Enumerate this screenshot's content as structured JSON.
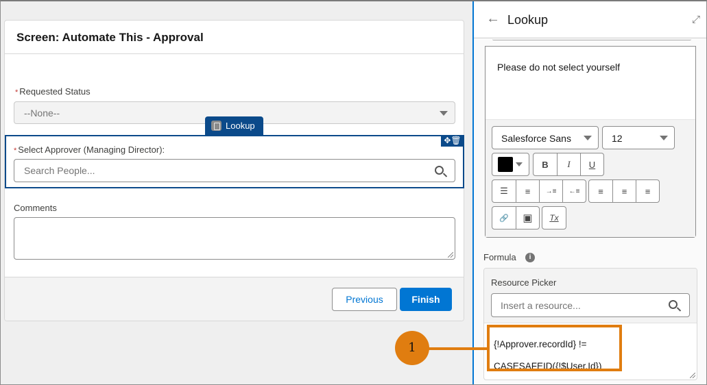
{
  "canvas": {
    "title": "Screen: Automate This - Approval",
    "fields": {
      "requested_status": {
        "label": "Requested Status",
        "required_marker": "*",
        "value": "--None--"
      },
      "approver": {
        "label": "Select Approver (Managing Director):",
        "required_marker": "*",
        "placeholder": "Search People...",
        "component_tab": "Lookup",
        "actions_glyph": "✥🗑"
      },
      "comments": {
        "label": "Comments",
        "value": ""
      }
    },
    "footer": {
      "previous_label": "Previous",
      "finish_label": "Finish"
    }
  },
  "panel": {
    "title": "Lookup",
    "back_glyph": "←",
    "expand_glyph": "⤢",
    "rich_text": {
      "content": "Please do not select yourself",
      "font_family": "Salesforce Sans",
      "font_size": "12",
      "text_color": "#000000",
      "toolbar": {
        "bold": "B",
        "italic": "I",
        "underline": "U",
        "bullet_list": "☰",
        "numbered_list": "≡",
        "indent": "→≡",
        "outdent": "←≡",
        "align_left": "≡",
        "align_center": "≡",
        "align_right": "≡",
        "link": "🔗",
        "image": "▣",
        "clear_format": "Tx"
      }
    },
    "formula": {
      "label": "Formula",
      "info_glyph": "i",
      "resource_picker_label": "Resource Picker",
      "resource_picker_placeholder": "Insert a resource...",
      "line1": "{!Approver.recordId} !=",
      "line2": "CASESAFEID({!$User.Id})"
    }
  },
  "callout": {
    "number": "1",
    "color": "#e07d10"
  },
  "colors": {
    "brand_blue": "#0176d3",
    "selection_navy": "#0b4a8a",
    "required_red": "#c23934"
  }
}
